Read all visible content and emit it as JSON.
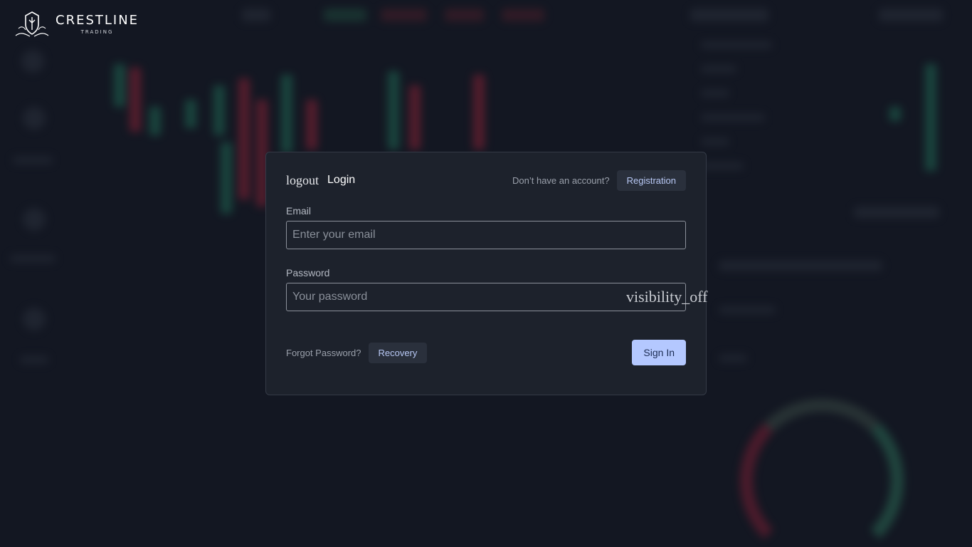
{
  "brand": {
    "name": "CRESTLINE",
    "tagline": "TRADING"
  },
  "login": {
    "title_icon": "logout",
    "title": "Login",
    "no_account_text": "Don’t have an account?",
    "registration_label": "Registration",
    "email": {
      "label": "Email",
      "placeholder": "Enter your email",
      "value": ""
    },
    "password": {
      "label": "Password",
      "placeholder": "Your password",
      "value": "",
      "toggle_icon": "visibility_off"
    },
    "forgot_text": "Forgot Password?",
    "recovery_label": "Recovery",
    "sign_in_label": "Sign In"
  },
  "colors": {
    "primary_button": "#b4c8ff",
    "dialog_bg": "#1d222c",
    "page_bg": "#131722"
  }
}
